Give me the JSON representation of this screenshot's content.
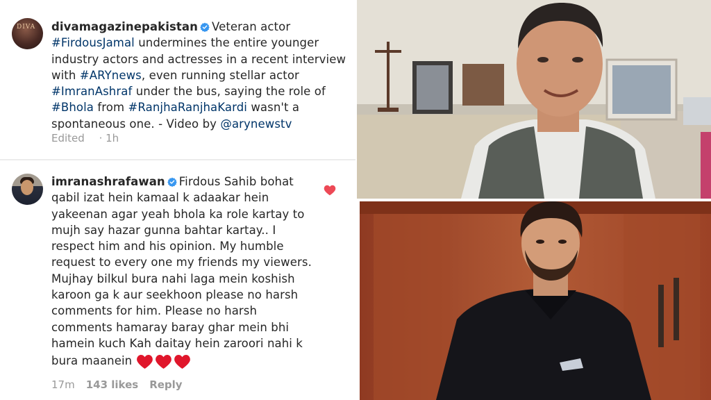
{
  "comments": [
    {
      "username": "divamagazinepakistan",
      "text_parts": [
        {
          "t": "Veteran actor ",
          "tag": false
        },
        {
          "t": "#FirdousJamal",
          "tag": true
        },
        {
          "t": " undermines the entire younger industry actors and actresses in a recent interview with ",
          "tag": false
        },
        {
          "t": "#ARYnews",
          "tag": true
        },
        {
          "t": ", even running stellar actor ",
          "tag": false
        },
        {
          "t": "#ImranAshraf",
          "tag": true
        },
        {
          "t": " under the bus, saying the role of ",
          "tag": false
        },
        {
          "t": "#Bhola",
          "tag": true
        },
        {
          "t": " from ",
          "tag": false
        },
        {
          "t": "#RanjhaRanjhaKardi",
          "tag": true
        },
        {
          "t": " wasn't a spontaneous one. - Video by ",
          "tag": false
        },
        {
          "t": "@arynewstv",
          "tag": true
        }
      ],
      "edited_label": "Edited",
      "time": "1h"
    },
    {
      "username": "imranashrafawan",
      "text": "Firdous Sahib bohat qabil izat hein kamaal k adaakar hein yakeenan agar yeah bhola ka role kartay to mujh say hazar gunna bahtar kartay.. I respect him and his opinion. My humble request to every one my friends my viewers. Mujhay bilkul bura nahi laga mein koshish karoon ga k aur seekhoon please no harsh comments for him. Please no harsh comments hamaray baray ghar mein bhi hamein kuch Kah daitay hein zaroori nahi k bura maanein",
      "time": "17m",
      "likes": "143 likes",
      "reply_label": "Reply"
    }
  ],
  "colors": {
    "text": "#262626",
    "hashtag": "#003569",
    "meta": "#999999",
    "verified_badge": "#3897f0",
    "heart": "#ed4956"
  },
  "icons": {
    "verified": "verified-badge-icon",
    "like": "heart-icon",
    "emoji": "red-heart-emoji"
  }
}
